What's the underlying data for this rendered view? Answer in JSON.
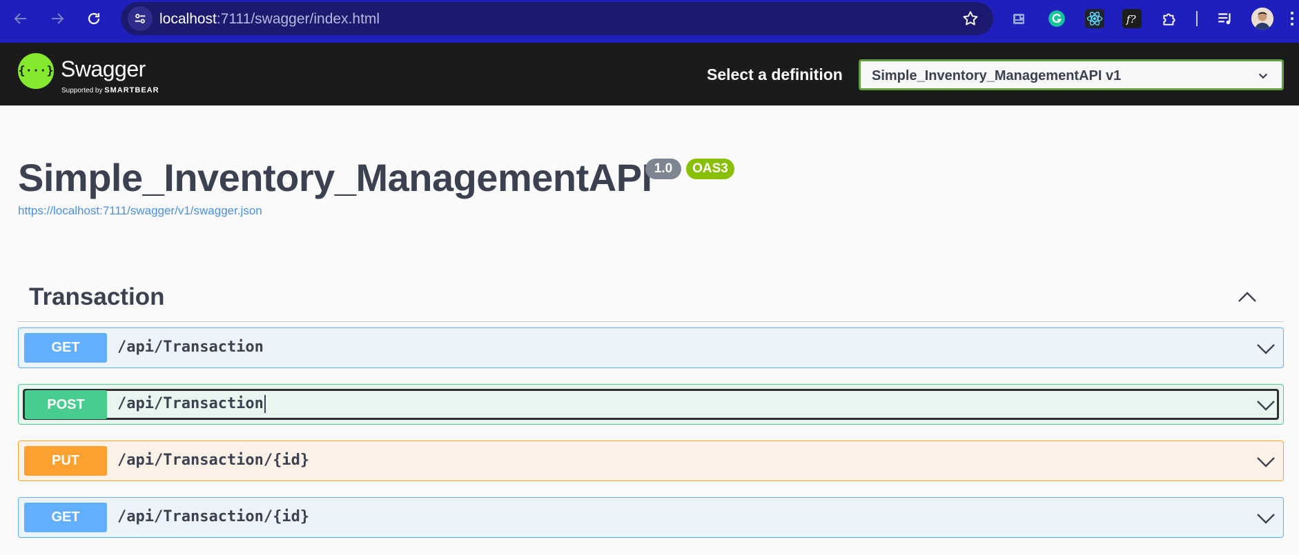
{
  "browser": {
    "url_host": "localhost",
    "url_rest": ":7111/swagger/index.html",
    "extensions": [
      "news-icon",
      "grammarly-icon",
      "react-devtools-icon",
      "fonts-ninja-icon",
      "extensions-puzzle-icon"
    ],
    "colors": {
      "toolbar": "#1f1fbd",
      "omnibox": "#1b1a6f"
    }
  },
  "topbar": {
    "logo_title": "Swagger",
    "logo_glyph": "{···}",
    "logo_sub_prefix": "Supported by",
    "logo_sub_brand": "SMARTBEAR",
    "definition_label": "Select a definition",
    "definition_selected": "Simple_Inventory_ManagementAPI v1",
    "colors": {
      "background": "#1b1b1b",
      "logo": "#85ea2d",
      "select_border": "#62a03f"
    }
  },
  "info": {
    "title": "Simple_Inventory_ManagementAPI",
    "version_badge": "1.0",
    "oas_badge": "OAS3",
    "spec_url": "https://localhost:7111/swagger/v1/swagger.json"
  },
  "tag": {
    "name": "Transaction",
    "expanded": true
  },
  "operations": [
    {
      "method": "GET",
      "path": "/api/Transaction",
      "color": "#61affe"
    },
    {
      "method": "POST",
      "path": "/api/Transaction",
      "color": "#49cc90",
      "focused": true
    },
    {
      "method": "PUT",
      "path": "/api/Transaction/{id}",
      "color": "#fca130"
    },
    {
      "method": "GET",
      "path": "/api/Transaction/{id}",
      "color": "#61affe"
    }
  ]
}
